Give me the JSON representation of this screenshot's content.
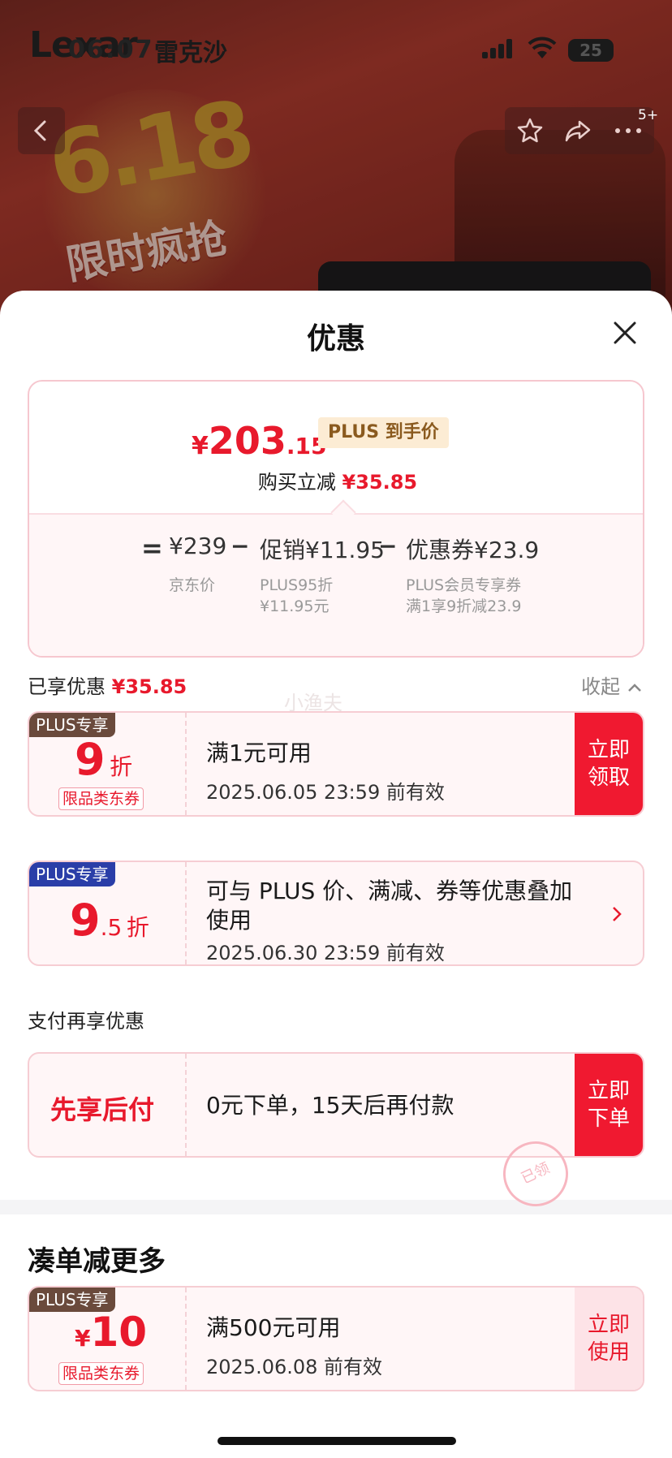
{
  "status_bar": {
    "brand": "Lexar",
    "brand_cn": "雷克沙",
    "time": "06:07",
    "battery": "25"
  },
  "bg_page": {
    "promo_618": "6.18",
    "promo_text": "限时疯抢",
    "notification_count": "5+"
  },
  "sheet": {
    "title": "优惠",
    "price": {
      "yen": "¥",
      "integer": "203",
      "decimal": ".15",
      "tag": "PLUS 到手价",
      "instant_cut_label": "购买立减",
      "instant_cut_value": "¥35.85"
    },
    "formula": {
      "equals": "=",
      "jd_price": "¥239",
      "minus": "−",
      "promo": "促销¥11.95",
      "coupon": "优惠券¥23.9",
      "jd_sub": "京东价",
      "promo_sub": "PLUS95折 ¥11.95元",
      "coupon_sub": "PLUS会员专享券 满1享9折减23.9"
    },
    "enjoyed_label": "已享优惠",
    "enjoyed_value": "¥35.85",
    "collapse_label": "收起",
    "watermark": "小渔夫",
    "coupons": [
      {
        "tag": "PLUS专享",
        "discount_big": "9",
        "discount_unit": "折",
        "category": "限品类东券",
        "title": "满1元可用",
        "date": "2025.06.05 23:59 前有效",
        "cta": "立即领取"
      },
      {
        "tag": "PLUS专享",
        "discount_big": "9",
        "discount_small": ".5",
        "discount_unit": "折",
        "title": "可与 PLUS 价、满减、券等优惠叠加使用",
        "date": "2025.06.30 23:59 前有效"
      }
    ],
    "pay_section_title": "支付再享优惠",
    "pay_card": {
      "name": "先享后付",
      "title": "0元下单，15天后再付款",
      "cta": "立即下单"
    },
    "more_title": "凑单减更多",
    "more_coupon": {
      "tag": "PLUS专享",
      "yen": "¥",
      "amount": "10",
      "category": "限品类东券",
      "title": "满500元可用",
      "date": "2025.06.08 前有效",
      "cta": "立即使用",
      "stamp": "已领"
    }
  },
  "colors": {
    "accent_red": "#e8192c",
    "plus_brown": "#6a4a3c",
    "plus_blue": "#2a3ea8"
  }
}
